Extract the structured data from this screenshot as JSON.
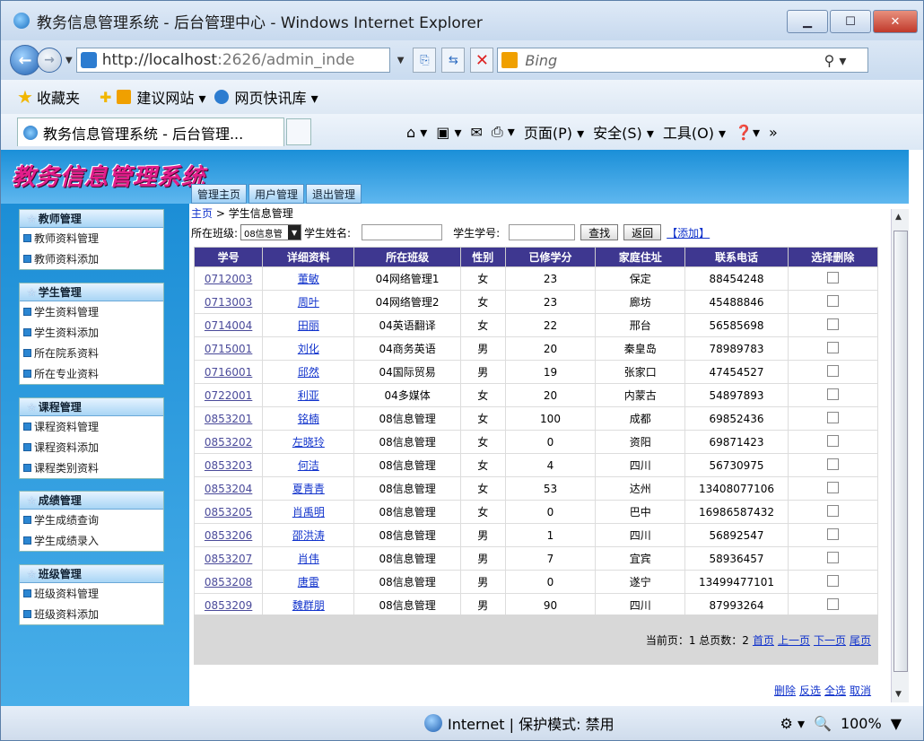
{
  "window": {
    "title": "教务信息管理系统 - 后台管理中心 - Windows Internet Explorer",
    "minimize_glyph": "▁",
    "maximize_glyph": "☐",
    "close_glyph": "✕"
  },
  "address_bar": {
    "url_main": "http://localhost",
    "url_rest": ":2626/admin_inde",
    "search_placeholder": "Bing"
  },
  "favorites_bar": {
    "favorites_label": "收藏夹",
    "items": [
      "建议网站 ▾",
      "网页快讯库 ▾"
    ]
  },
  "tab": {
    "title": "教务信息管理系统 - 后台管理...",
    "commands": [
      "页面(P) ▾",
      "安全(S) ▾",
      "工具(O) ▾"
    ]
  },
  "app": {
    "logo_text": "教务信息管理系统",
    "top_nav": [
      "管理主页",
      "用户管理",
      "退出管理"
    ],
    "breadcrumb": {
      "home": "主页",
      "sep": " > ",
      "current": "学生信息管理"
    },
    "filter": {
      "class_label": "所在班级:",
      "class_value": "08信息管",
      "name_label": "学生姓名:",
      "number_label": "学生学号:",
      "search_button": "查找",
      "back_button": "返回",
      "add_link": "【添加】"
    },
    "menus": [
      {
        "title": "教师管理",
        "items": [
          "教师资料管理",
          "教师资料添加"
        ]
      },
      {
        "title": "学生管理",
        "items": [
          "学生资料管理",
          "学生资料添加",
          "所在院系资料",
          "所在专业资料"
        ]
      },
      {
        "title": "课程管理",
        "items": [
          "课程资料管理",
          "课程资料添加",
          "课程类别资料"
        ]
      },
      {
        "title": "成绩管理",
        "items": [
          "学生成绩查询",
          "学生成绩录入"
        ]
      },
      {
        "title": "班级管理",
        "items": [
          "班级资料管理",
          "班级资料添加"
        ]
      }
    ],
    "table": {
      "headers": [
        "学号",
        "详细资料",
        "所在班级",
        "性别",
        "已修学分",
        "家庭住址",
        "联系电话",
        "选择删除"
      ],
      "rows": [
        [
          "0712003",
          "董敏",
          "04网络管理1",
          "女",
          "23",
          "保定",
          "88454248"
        ],
        [
          "0713003",
          "周叶",
          "04网络管理2",
          "女",
          "23",
          "廊坊",
          "45488846"
        ],
        [
          "0714004",
          "田丽",
          "04英语翻译",
          "女",
          "22",
          "邢台",
          "56585698"
        ],
        [
          "0715001",
          "刘化",
          "04商务英语",
          "男",
          "20",
          "秦皇岛",
          "78989783"
        ],
        [
          "0716001",
          "邱然",
          "04国际贸易",
          "男",
          "19",
          "张家口",
          "47454527"
        ],
        [
          "0722001",
          "利亚",
          "04多媒体",
          "女",
          "20",
          "内蒙古",
          "54897893"
        ],
        [
          "0853201",
          "铭楠",
          "08信息管理",
          "女",
          "100",
          "成都",
          "69852436"
        ],
        [
          "0853202",
          "左晓玲",
          "08信息管理",
          "女",
          "0",
          "资阳",
          "69871423"
        ],
        [
          "0853203",
          "何洁",
          "08信息管理",
          "女",
          "4",
          "四川",
          "56730975"
        ],
        [
          "0853204",
          "夏青青",
          "08信息管理",
          "女",
          "53",
          "达州",
          "13408077106"
        ],
        [
          "0853205",
          "肖禹明",
          "08信息管理",
          "女",
          "0",
          "巴中",
          "16986587432"
        ],
        [
          "0853206",
          "邵洪涛",
          "08信息管理",
          "男",
          "1",
          "四川",
          "56892547"
        ],
        [
          "0853207",
          "肖伟",
          "08信息管理",
          "男",
          "7",
          "宜宾",
          "58936457"
        ],
        [
          "0853208",
          "唐雷",
          "08信息管理",
          "男",
          "0",
          "遂宁",
          "13499477101"
        ],
        [
          "0853209",
          "魏群朋",
          "08信息管理",
          "男",
          "90",
          "四川",
          "87993264"
        ]
      ]
    },
    "pager": {
      "info": "当前页：1 总页数：2",
      "links": [
        "首页",
        "上一页",
        "下一页",
        "尾页"
      ]
    },
    "actions": [
      "删除",
      "反选",
      "全选",
      "取消"
    ]
  },
  "status_bar": {
    "zone": "Internet | 保护模式: 禁用",
    "zoom": "100%"
  }
}
